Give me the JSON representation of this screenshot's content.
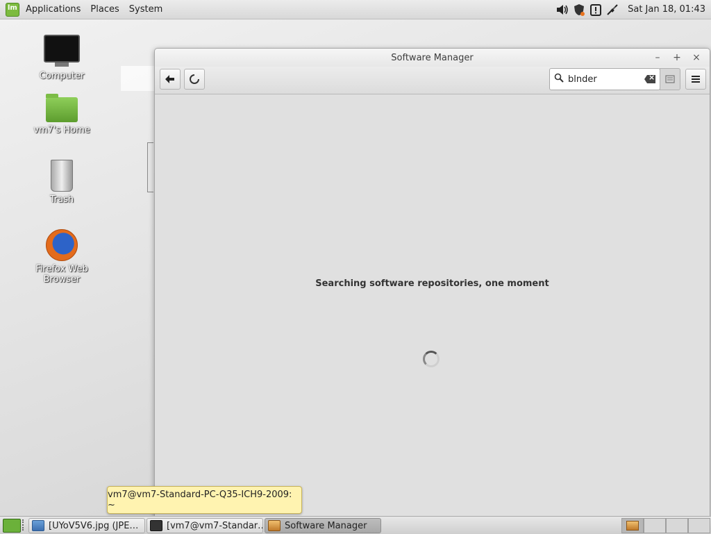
{
  "top_panel": {
    "menus": [
      "Applications",
      "Places",
      "System"
    ],
    "clock": "Sat Jan 18, 01:43",
    "tray_icons": [
      "volume-icon",
      "security-shield-icon",
      "update-manager-icon",
      "network-icon"
    ]
  },
  "desktop": {
    "icons": [
      {
        "label": "Computer",
        "icon": "computer-icon"
      },
      {
        "label": "vm7's Home",
        "icon": "home-folder-icon"
      },
      {
        "label": "Trash",
        "icon": "trash-icon"
      },
      {
        "label": "Firefox Web Browser",
        "icon": "firefox-icon"
      }
    ]
  },
  "window": {
    "title": "Software Manager",
    "controls": [
      "–",
      "+",
      "×"
    ],
    "search": {
      "value": "blnder"
    },
    "status_text": "Searching software repositories, one moment"
  },
  "tooltip": {
    "text": "vm7@vm7-Standard-PC-Q35-ICH9-2009: ~"
  },
  "taskbar": {
    "tasks": [
      {
        "label": "[UYoV5V6.jpg (JPE…",
        "active": false
      },
      {
        "label": "[vm7@vm7-Standar…",
        "active": false
      },
      {
        "label": "Software Manager",
        "active": true
      }
    ]
  },
  "colors": {
    "accent_green": "#6bb13a",
    "tooltip_bg": "#fff3b0"
  }
}
